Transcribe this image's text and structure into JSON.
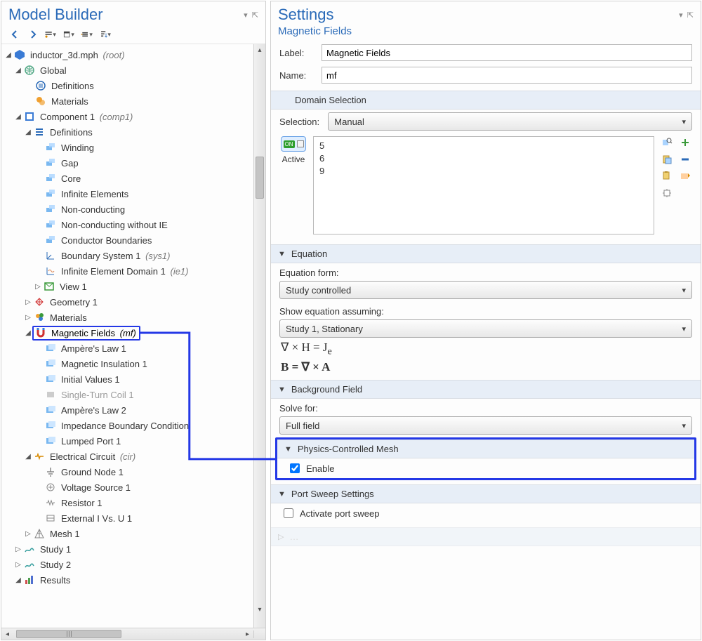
{
  "left": {
    "title": "Model Builder",
    "tree": {
      "root": "inductor_3d.mph",
      "root_tag": "(root)",
      "global": "Global",
      "definitions_g": "Definitions",
      "materials_g": "Materials",
      "comp1": "Component 1",
      "comp1_tag": "(comp1)",
      "definitions_c": "Definitions",
      "def_items": [
        "Winding",
        "Gap",
        "Core",
        "Infinite Elements",
        "Non-conducting",
        "Non-conducting without IE",
        "Conductor Boundaries"
      ],
      "bsys": "Boundary System 1",
      "bsys_tag": "(sys1)",
      "ied": "Infinite Element Domain 1",
      "ied_tag": "(ie1)",
      "view": "View 1",
      "geom": "Geometry 1",
      "materials_c": "Materials",
      "mf": "Magnetic Fields",
      "mf_tag": "(mf)",
      "mf_children": [
        "Ampère's Law 1",
        "Magnetic Insulation 1",
        "Initial Values 1",
        "Single-Turn Coil 1",
        "Ampère's Law 2",
        "Impedance Boundary Condition",
        "Lumped Port 1"
      ],
      "cir": "Electrical Circuit",
      "cir_tag": "(cir)",
      "cir_children": [
        "Ground Node 1",
        "Voltage Source 1",
        "Resistor 1",
        "External I Vs. U 1"
      ],
      "mesh": "Mesh 1",
      "study1": "Study 1",
      "study2": "Study 2",
      "results": "Results"
    }
  },
  "right": {
    "title": "Settings",
    "subtitle": "Magnetic Fields",
    "label_l": "Label:",
    "label_v": "Magnetic Fields",
    "name_l": "Name:",
    "name_v": "mf",
    "section_domain": "Domain Selection",
    "selection_l": "Selection:",
    "selection_v": "Manual",
    "active_l": "Active",
    "domain_list": [
      "5",
      "6",
      "9"
    ],
    "section_eq": "Equation",
    "eq_form_l": "Equation form:",
    "eq_form_v": "Study controlled",
    "eq_assume_l": "Show equation assuming:",
    "eq_assume_v": "Study 1, Stationary",
    "eq1": "∇ × H = J",
    "eq1_sub": "e",
    "eq2": "B = ∇ × A",
    "section_bg": "Background Field",
    "solve_l": "Solve for:",
    "solve_v": "Full field",
    "section_mesh": "Physics-Controlled Mesh",
    "mesh_enable": "Enable",
    "section_port": "Port Sweep Settings",
    "port_activate": "Activate port sweep"
  }
}
